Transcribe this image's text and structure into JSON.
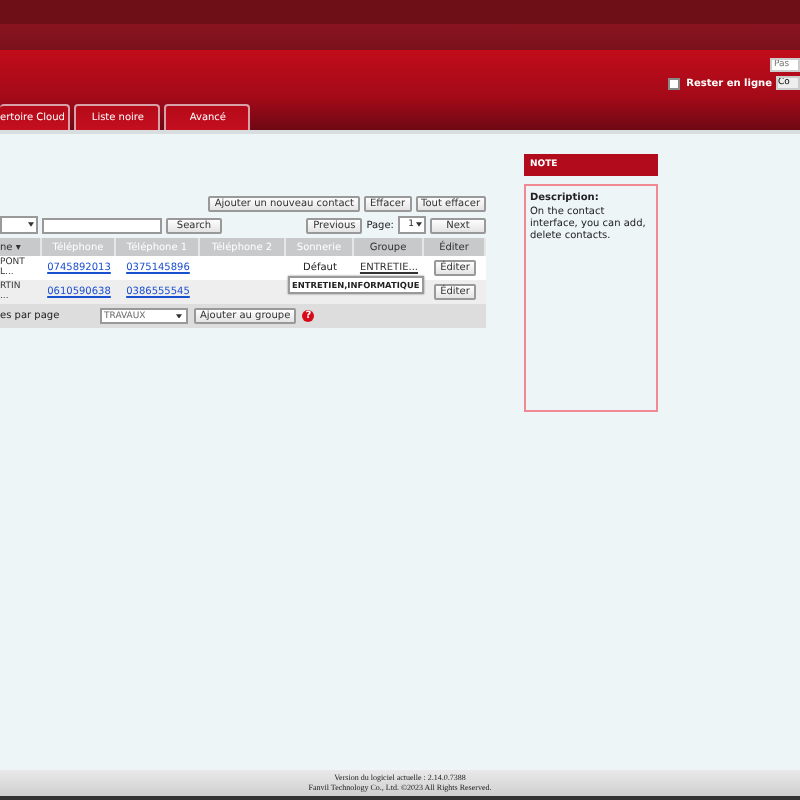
{
  "header": {
    "password_placeholder": "Pas",
    "login_button": "Co",
    "stay_online": {
      "label": "Rester en ligne",
      "checked": false
    }
  },
  "tabs": [
    {
      "label": "ertoire Cloud",
      "selected": false
    },
    {
      "label": "Liste noire",
      "selected": false
    },
    {
      "label": "Avancé",
      "selected": false
    }
  ],
  "toolbar": {
    "buttons": [
      "Ajouter un nouveau contact",
      "Effacer",
      "Tout effacer"
    ],
    "search_button": "Search",
    "previous": "Previous",
    "page_label": "Page:",
    "page_value": "1",
    "next": "Next"
  },
  "table": {
    "columns": [
      "ne ▾",
      "Téléphone",
      "Téléphone 1",
      "Téléphone 2",
      "Sonnerie",
      "Groupe",
      "Éditer"
    ],
    "rows": [
      {
        "name": [
          "PONT",
          "L..."
        ],
        "phone": "0745892013",
        "phone1": "0375145896",
        "phone2": "",
        "ring": "Défaut",
        "group": "ENTRETIE...",
        "edit": "Éditer"
      },
      {
        "name": [
          "RTIN",
          "..."
        ],
        "phone": "0610590638",
        "phone1": "0386555545",
        "phone2": "",
        "ring": "",
        "group": "",
        "edit": "Éditer"
      }
    ],
    "per_page_label": "es par page",
    "group_select": "TRAVAUX",
    "add_to_group": "Ajouter au groupe",
    "help_icon": "?"
  },
  "tooltip": "ENTRETIEN,INFORMATIQUE",
  "note": {
    "title": "NOTE",
    "heading": "Description:",
    "text": "On the contact interface, you can add, delete contacts."
  },
  "footer": [
    "Version du logiciel actuelle : 2.14.0.7388",
    "Fanvil Technology Co., Ltd. ©2023 All Rights Reserved."
  ]
}
